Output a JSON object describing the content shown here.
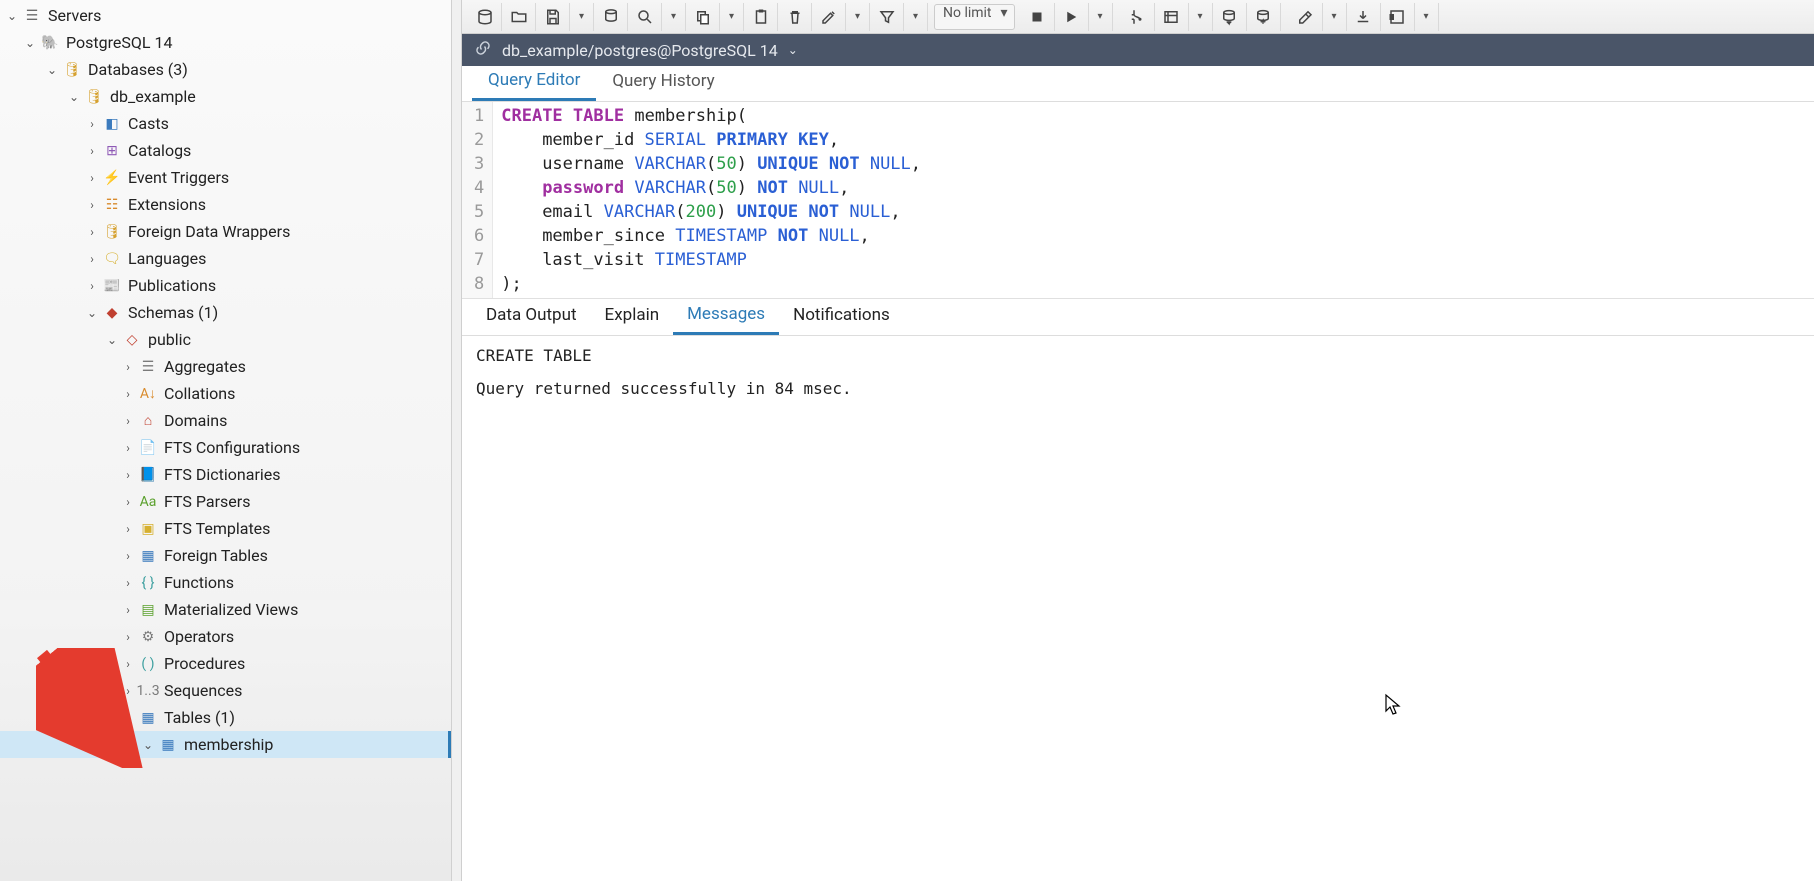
{
  "tree": {
    "servers": "Servers",
    "postgres": "PostgreSQL 14",
    "databases": "Databases (3)",
    "db": "db_example",
    "casts": "Casts",
    "catalogs": "Catalogs",
    "event_triggers": "Event Triggers",
    "extensions": "Extensions",
    "fdw": "Foreign Data Wrappers",
    "languages": "Languages",
    "publications": "Publications",
    "schemas": "Schemas (1)",
    "public": "public",
    "aggregates": "Aggregates",
    "collations": "Collations",
    "domains": "Domains",
    "fts_config": "FTS Configurations",
    "fts_dict": "FTS Dictionaries",
    "fts_parsers": "FTS Parsers",
    "fts_templates": "FTS Templates",
    "foreign_tables": "Foreign Tables",
    "functions": "Functions",
    "mat_views": "Materialized Views",
    "operators": "Operators",
    "procedures": "Procedures",
    "sequences": "Sequences",
    "tables": "Tables (1)",
    "membership": "membership"
  },
  "toolbar": {
    "limit": "No limit"
  },
  "context": "db_example/postgres@PostgreSQL 14",
  "query_tabs": {
    "editor": "Query Editor",
    "history": "Query History"
  },
  "editor": {
    "line_numbers": [
      "1",
      "2",
      "3",
      "4",
      "5",
      "6",
      "7",
      "8"
    ],
    "lines": [
      [
        [
          "kw-purple",
          "CREATE"
        ],
        [
          "kw-ident",
          " "
        ],
        [
          "kw-purple",
          "TABLE"
        ],
        [
          "kw-ident",
          " membership"
        ],
        [
          "kw-ident",
          "("
        ]
      ],
      [
        [
          "kw-ident",
          "    member_id "
        ],
        [
          "kw-type",
          "SERIAL"
        ],
        [
          "kw-ident",
          " "
        ],
        [
          "kw-bluekw",
          "PRIMARY"
        ],
        [
          "kw-ident",
          " "
        ],
        [
          "kw-bluekw",
          "KEY"
        ],
        [
          "kw-ident",
          ","
        ]
      ],
      [
        [
          "kw-ident",
          "    username "
        ],
        [
          "kw-type",
          "VARCHAR"
        ],
        [
          "kw-ident",
          "("
        ],
        [
          "kw-num",
          "50"
        ],
        [
          "kw-ident",
          ") "
        ],
        [
          "kw-bluekw",
          "UNIQUE"
        ],
        [
          "kw-ident",
          " "
        ],
        [
          "kw-bluekw",
          "NOT"
        ],
        [
          "kw-ident",
          " "
        ],
        [
          "kw-type",
          "NULL"
        ],
        [
          "kw-ident",
          ","
        ]
      ],
      [
        [
          "kw-ident",
          "    "
        ],
        [
          "kw-purple",
          "password"
        ],
        [
          "kw-ident",
          " "
        ],
        [
          "kw-type",
          "VARCHAR"
        ],
        [
          "kw-ident",
          "("
        ],
        [
          "kw-num",
          "50"
        ],
        [
          "kw-ident",
          ") "
        ],
        [
          "kw-bluekw",
          "NOT"
        ],
        [
          "kw-ident",
          " "
        ],
        [
          "kw-type",
          "NULL"
        ],
        [
          "kw-ident",
          ","
        ]
      ],
      [
        [
          "kw-ident",
          "    email "
        ],
        [
          "kw-type",
          "VARCHAR"
        ],
        [
          "kw-ident",
          "("
        ],
        [
          "kw-num",
          "200"
        ],
        [
          "kw-ident",
          ") "
        ],
        [
          "kw-bluekw",
          "UNIQUE"
        ],
        [
          "kw-ident",
          " "
        ],
        [
          "kw-bluekw",
          "NOT"
        ],
        [
          "kw-ident",
          " "
        ],
        [
          "kw-type",
          "NULL"
        ],
        [
          "kw-ident",
          ","
        ]
      ],
      [
        [
          "kw-ident",
          "    member_since "
        ],
        [
          "kw-type",
          "TIMESTAMP"
        ],
        [
          "kw-ident",
          " "
        ],
        [
          "kw-bluekw",
          "NOT"
        ],
        [
          "kw-ident",
          " "
        ],
        [
          "kw-type",
          "NULL"
        ],
        [
          "kw-ident",
          ","
        ]
      ],
      [
        [
          "kw-ident",
          "    last_visit "
        ],
        [
          "kw-type",
          "TIMESTAMP"
        ]
      ],
      [
        [
          "kw-ident",
          ");"
        ]
      ]
    ]
  },
  "output_tabs": {
    "data": "Data Output",
    "explain": "Explain",
    "messages": "Messages",
    "notifications": "Notifications"
  },
  "messages": {
    "l1": "CREATE TABLE",
    "l2": "Query returned successfully in 84 msec."
  }
}
